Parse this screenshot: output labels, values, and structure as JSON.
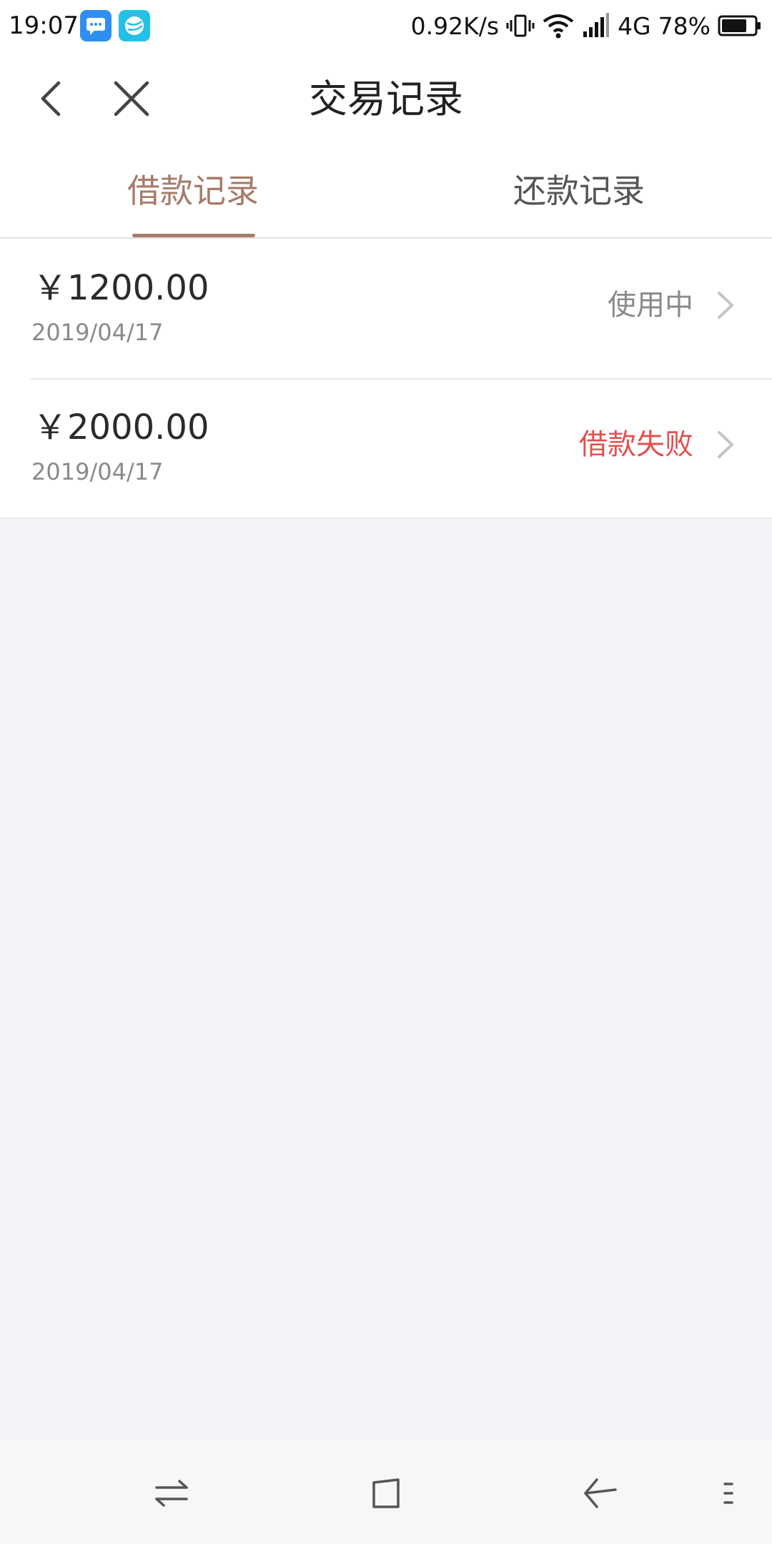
{
  "status_bar": {
    "time": "19:07",
    "net_speed": "0.92K/s",
    "network": "4G",
    "battery": "78%",
    "battery_level": 0.78,
    "icons": [
      "message-notification-icon",
      "app-notification-icon",
      "vibrate-icon",
      "wifi-icon",
      "signal-icon",
      "battery-icon"
    ]
  },
  "header": {
    "title": "交易记录",
    "back_icon": "chevron-left-icon",
    "close_icon": "close-icon"
  },
  "tabs": [
    {
      "label": "借款记录",
      "active": true
    },
    {
      "label": "还款记录",
      "active": false
    }
  ],
  "records": [
    {
      "amount": "￥1200.00",
      "date": "2019/04/17",
      "status": "使用中",
      "status_color": "#8a8a8a"
    },
    {
      "amount": "￥2000.00",
      "date": "2019/04/17",
      "status": "借款失败",
      "status_color": "#e0514f"
    }
  ],
  "colors": {
    "accent": "#a57c6b",
    "page_background": "#f2f2f7",
    "failed": "#e0514f"
  },
  "bottom_nav": {
    "icons": [
      "switch-apps-icon",
      "home-icon",
      "back-icon",
      "menu-icon"
    ]
  }
}
